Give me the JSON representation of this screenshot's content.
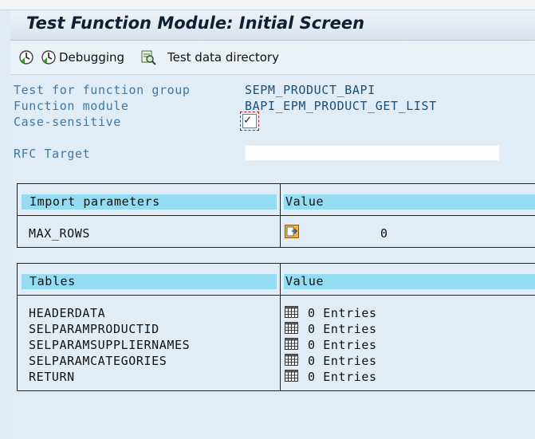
{
  "window": {
    "title": "Test Function Module: Initial Screen"
  },
  "toolbar": {
    "execute_icon": "execute-clock-icon",
    "debugging_label": "Debugging",
    "debugging_icon": "debug-clock-icon",
    "test_data_label": "Test data directory",
    "test_data_icon": "magnifier-list-icon"
  },
  "form": {
    "fields": [
      {
        "label": "Test for function group",
        "value": "SEPM_PRODUCT_BAPI"
      },
      {
        "label": "Function module",
        "value": "BAPI_EPM_PRODUCT_GET_LIST"
      },
      {
        "label": "Case-sensitive",
        "checked": true
      },
      {
        "label": "RFC Target",
        "value": ""
      }
    ]
  },
  "import_params": {
    "header_name": "Import parameters",
    "header_value": "Value",
    "rows": [
      {
        "name": "MAX_ROWS",
        "value": "0",
        "icon": "input-help-icon"
      }
    ]
  },
  "tables": {
    "header_name": "Tables",
    "header_value": "Value",
    "rows": [
      {
        "name": "HEADERDATA",
        "value": "0 Entries"
      },
      {
        "name": "SELPARAMPRODUCTID",
        "value": "0 Entries"
      },
      {
        "name": "SELPARAMSUPPLIERNAMES",
        "value": "0 Entries"
      },
      {
        "name": "SELPARAMCATEGORIES",
        "value": "0 Entries"
      },
      {
        "name": "RETURN",
        "value": "0 Entries"
      }
    ],
    "row_icon": "table-grid-icon"
  }
}
